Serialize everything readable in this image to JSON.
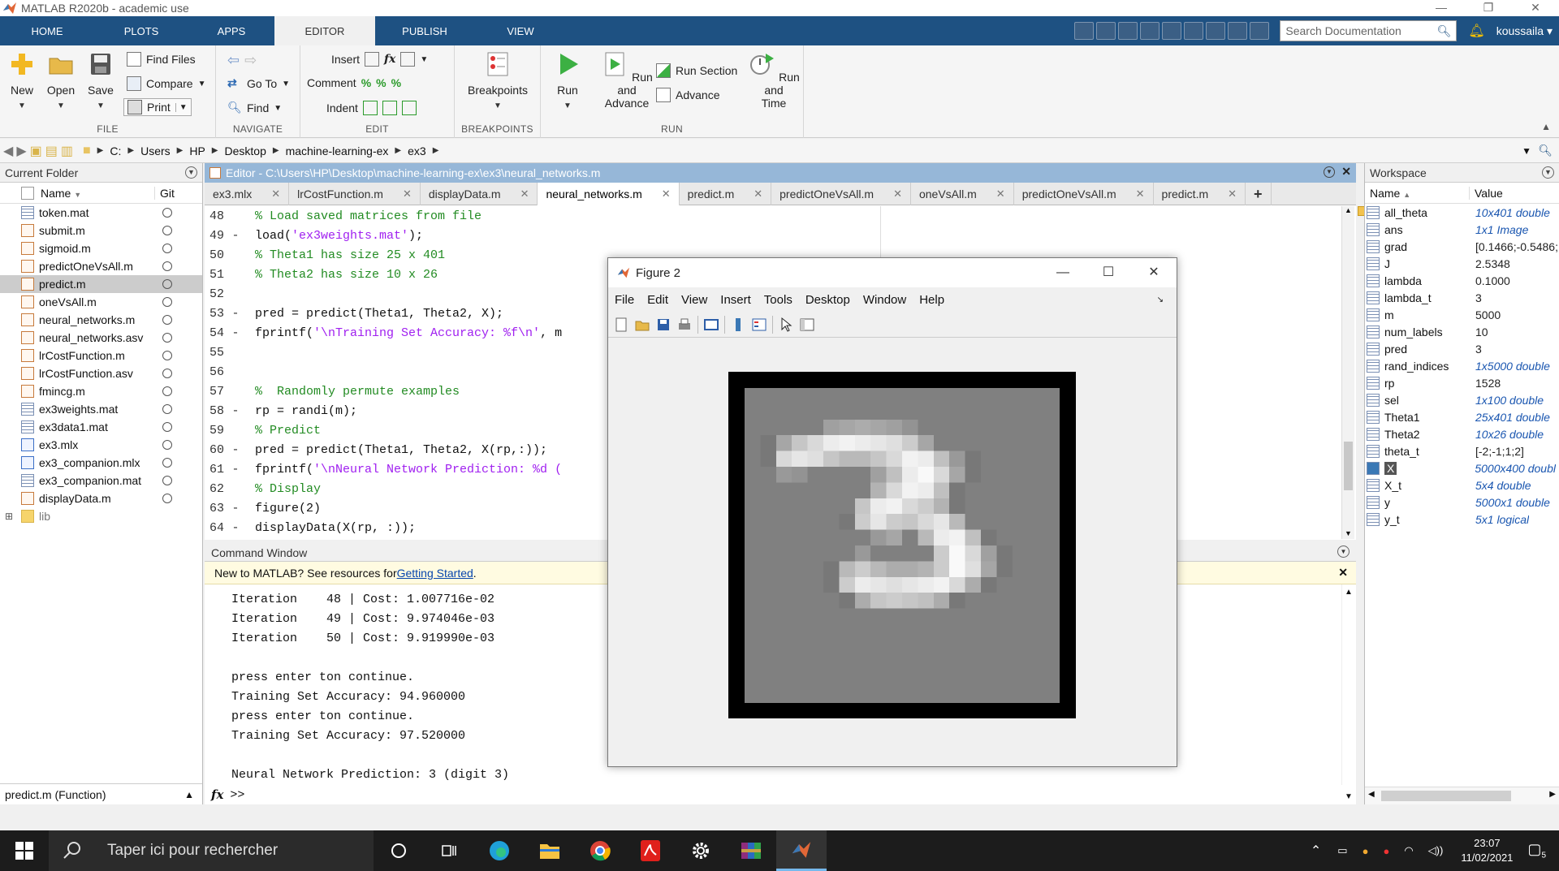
{
  "window": {
    "title": "MATLAB R2020b - academic use",
    "controls": [
      "—",
      "❐",
      "✕"
    ]
  },
  "ribbon": {
    "tabs": [
      "HOME",
      "PLOTS",
      "APPS",
      "EDITOR",
      "PUBLISH",
      "VIEW"
    ],
    "active_tab": "EDITOR",
    "search_placeholder": "Search Documentation",
    "user": "koussaila",
    "accent": "#1e5182"
  },
  "toolstrip": {
    "file": {
      "label": "FILE",
      "new": "New",
      "open": "Open",
      "save": "Save",
      "find_files": "Find Files",
      "compare": "Compare",
      "print": "Print"
    },
    "navigate": {
      "label": "NAVIGATE",
      "go_to": "Go To",
      "find": "Find"
    },
    "edit": {
      "label": "EDIT",
      "insert": "Insert",
      "comment": "Comment",
      "indent": "Indent",
      "fx": "fx"
    },
    "breakpoints": {
      "label": "BREAKPOINTS",
      "breakpoints": "Breakpoints"
    },
    "run": {
      "label": "RUN",
      "run": "Run",
      "run_and_advance_1": "Run and",
      "run_and_advance_2": "Advance",
      "run_section": "Run Section",
      "advance": "Advance",
      "run_and_time_1": "Run and",
      "run_and_time_2": "Time"
    }
  },
  "address": {
    "crumbs": [
      "C:",
      "Users",
      "HP",
      "Desktop",
      "machine-learning-ex",
      "ex3"
    ]
  },
  "current_folder": {
    "title": "Current Folder",
    "col_name": "Name",
    "col_git": "Git",
    "files": [
      {
        "name": "token.mat",
        "type": "mat"
      },
      {
        "name": "submit.m",
        "type": "m"
      },
      {
        "name": "sigmoid.m",
        "type": "m"
      },
      {
        "name": "predictOneVsAll.m",
        "type": "m"
      },
      {
        "name": "predict.m",
        "type": "m"
      },
      {
        "name": "oneVsAll.m",
        "type": "m"
      },
      {
        "name": "neural_networks.m",
        "type": "m"
      },
      {
        "name": "neural_networks.asv",
        "type": "m"
      },
      {
        "name": "lrCostFunction.m",
        "type": "m"
      },
      {
        "name": "lrCostFunction.asv",
        "type": "m"
      },
      {
        "name": "fmincg.m",
        "type": "m"
      },
      {
        "name": "ex3weights.mat",
        "type": "mat"
      },
      {
        "name": "ex3data1.mat",
        "type": "mat"
      },
      {
        "name": "ex3.mlx",
        "type": "mlx"
      },
      {
        "name": "ex3_companion.mlx",
        "type": "mlx"
      },
      {
        "name": "ex3_companion.mat",
        "type": "mat"
      },
      {
        "name": "displayData.m",
        "type": "m"
      },
      {
        "name": "lib",
        "type": "folder"
      }
    ],
    "selected": "predict.m",
    "footer": "predict.m  (Function)"
  },
  "editor": {
    "title": "Editor - C:\\Users\\HP\\Desktop\\machine-learning-ex\\ex3\\neural_networks.m",
    "tabs": [
      "ex3.mlx",
      "lrCostFunction.m",
      "displayData.m",
      "neural_networks.m",
      "predict.m",
      "predictOneVsAll.m",
      "oneVsAll.m",
      "predictOneVsAll.m",
      "predict.m"
    ],
    "active_tab": "neural_networks.m",
    "add_tab": "+",
    "lines": [
      {
        "n": "48",
        "dash": "",
        "code": "% Load saved matrices from file",
        "kind": "comment"
      },
      {
        "n": "49",
        "dash": "-",
        "pre": "load(",
        "str": "'ex3weights.mat'",
        "post": ");",
        "kind": "string"
      },
      {
        "n": "50",
        "dash": "",
        "code": "% Theta1 has size 25 x 401",
        "kind": "comment"
      },
      {
        "n": "51",
        "dash": "",
        "code": "% Theta2 has size 10 x 26",
        "kind": "comment"
      },
      {
        "n": "52",
        "dash": "",
        "code": "",
        "kind": "code"
      },
      {
        "n": "53",
        "dash": "-",
        "code": "pred = predict(Theta1, Theta2, X);",
        "kind": "code"
      },
      {
        "n": "54",
        "dash": "-",
        "pre": "fprintf(",
        "str": "'\\nTraining Set Accuracy: %f\\n'",
        "post": ", m",
        "kind": "string"
      },
      {
        "n": "55",
        "dash": "",
        "code": "",
        "kind": "code"
      },
      {
        "n": "56",
        "dash": "",
        "code": "",
        "kind": "code"
      },
      {
        "n": "57",
        "dash": "",
        "code": "%  Randomly permute examples",
        "kind": "comment"
      },
      {
        "n": "58",
        "dash": "-",
        "code": "rp = randi(m);",
        "kind": "code"
      },
      {
        "n": "59",
        "dash": "",
        "code": "% Predict",
        "kind": "comment"
      },
      {
        "n": "60",
        "dash": "-",
        "code": "pred = predict(Theta1, Theta2, X(rp,:));",
        "kind": "code"
      },
      {
        "n": "61",
        "dash": "-",
        "pre": "fprintf(",
        "str": "'\\nNeural Network Prediction: %d (",
        "post": "",
        "kind": "string"
      },
      {
        "n": "62",
        "dash": "",
        "code": "% Display",
        "kind": "comment"
      },
      {
        "n": "63",
        "dash": "-",
        "code": "figure(2)",
        "kind": "code"
      },
      {
        "n": "64",
        "dash": "-",
        "code": "displayData(X(rp, :));",
        "kind": "code"
      }
    ]
  },
  "command_window": {
    "title": "Command Window",
    "info_text": "New to MATLAB? See resources for ",
    "info_link": "Getting Started",
    "info_end": ".",
    "output": [
      "Iteration    48 | Cost: 1.007716e-02",
      "Iteration    49 | Cost: 9.974046e-03",
      "Iteration    50 | Cost: 9.919990e-03",
      "",
      "press enter ton continue.",
      "Training Set Accuracy: 94.960000",
      "press enter ton continue.",
      "Training Set Accuracy: 97.520000",
      "",
      "Neural Network Prediction: 3 (digit 3)"
    ],
    "prompt_fx": "fx",
    "prompt": ">>"
  },
  "workspace": {
    "title": "Workspace",
    "col_name": "Name",
    "col_value": "Value",
    "vars": [
      {
        "name": "all_theta",
        "value": "10x401 double",
        "italic": true
      },
      {
        "name": "ans",
        "value": "1x1 Image",
        "italic": true
      },
      {
        "name": "grad",
        "value": "[0.1466;-0.5486;",
        "italic": false
      },
      {
        "name": "J",
        "value": "2.5348",
        "italic": false
      },
      {
        "name": "lambda",
        "value": "0.1000",
        "italic": false
      },
      {
        "name": "lambda_t",
        "value": "3",
        "italic": false
      },
      {
        "name": "m",
        "value": "5000",
        "italic": false
      },
      {
        "name": "num_labels",
        "value": "10",
        "italic": false
      },
      {
        "name": "pred",
        "value": "3",
        "italic": false
      },
      {
        "name": "rand_indices",
        "value": "1x5000 double",
        "italic": true
      },
      {
        "name": "rp",
        "value": "1528",
        "italic": false
      },
      {
        "name": "sel",
        "value": "1x100 double",
        "italic": true
      },
      {
        "name": "Theta1",
        "value": "25x401 double",
        "italic": true
      },
      {
        "name": "Theta2",
        "value": "10x26 double",
        "italic": true
      },
      {
        "name": "theta_t",
        "value": "[-2;-1;1;2]",
        "italic": false
      },
      {
        "name": "X",
        "value": "5000x400 doubl",
        "italic": true
      },
      {
        "name": "X_t",
        "value": "5x4 double",
        "italic": true
      },
      {
        "name": "y",
        "value": "5000x1 double",
        "italic": true
      },
      {
        "name": "y_t",
        "value": "5x1 logical",
        "italic": true
      }
    ]
  },
  "figure": {
    "title": "Figure 2",
    "menu": [
      "File",
      "Edit",
      "View",
      "Insert",
      "Tools",
      "Desktop",
      "Window",
      "Help"
    ]
  },
  "taskbar": {
    "search_placeholder": "Taper ici pour rechercher",
    "time": "23:07",
    "date": "11/02/2021",
    "notifications": "5"
  }
}
